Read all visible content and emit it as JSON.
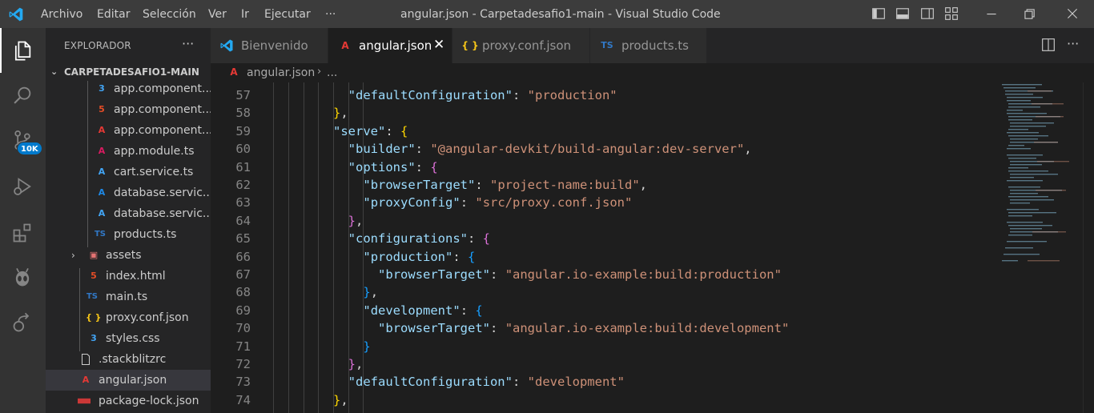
{
  "colors": {
    "accent": "#007acc",
    "titlebar": "#3c3c3c",
    "activitybar": "#333333",
    "sidebar": "#252526",
    "editor": "#1e1e1e",
    "json_key": "#9cdcfe",
    "json_string": "#ce9178",
    "bracket_1": "#da70d6",
    "bracket_2": "#179fff",
    "bracket_3": "#ffd700"
  },
  "titlebar": {
    "menu": [
      "Archivo",
      "Editar",
      "Selección",
      "Ver",
      "Ir",
      "Ejecutar",
      "···"
    ],
    "title": "angular.json - Carpetadesafio1-main - Visual Studio Code",
    "icons": [
      "toggle-primary-sidebar-icon",
      "toggle-panel-icon",
      "toggle-secondary-sidebar-icon",
      "customize-layout-icon",
      "minimize-icon",
      "restore-icon",
      "close-icon"
    ]
  },
  "activitybar": {
    "icons": [
      "explorer-icon",
      "search-icon",
      "source-control-icon",
      "run-debug-icon",
      "extensions-icon",
      "alien-icon",
      "remote-explorer-icon"
    ],
    "badge": "10K"
  },
  "sidebar": {
    "title": "EXPLORADOR",
    "more": "···",
    "folder": "CARPETADESAFIO1-MAIN",
    "items": [
      {
        "label": "app.component....",
        "icon": "css-file-icon"
      },
      {
        "label": "app.component....",
        "icon": "html-file-icon"
      },
      {
        "label": "app.component....",
        "icon": "angular-file-icon"
      },
      {
        "label": "app.module.ts",
        "icon": "angular-module-icon"
      },
      {
        "label": "cart.service.ts",
        "icon": "angular-service-icon"
      },
      {
        "label": "database.servic...",
        "icon": "angular-service-spec-icon"
      },
      {
        "label": "database.servic...",
        "icon": "angular-service-icon"
      },
      {
        "label": "products.ts",
        "icon": "typescript-file-icon"
      },
      {
        "label": "assets",
        "icon": "assets-folder-icon"
      },
      {
        "label": "index.html",
        "icon": "html-file-icon"
      },
      {
        "label": "main.ts",
        "icon": "typescript-file-icon"
      },
      {
        "label": "proxy.conf.json",
        "icon": "json-file-icon"
      },
      {
        "label": "styles.css",
        "icon": "css-file-icon"
      },
      {
        "label": ".stackblitzrc",
        "icon": "plain-file-icon"
      },
      {
        "label": "angular.json",
        "icon": "angular-file-icon"
      },
      {
        "label": "package-lock.json",
        "icon": "npm-file-icon"
      }
    ]
  },
  "tabs": [
    {
      "label": "Bienvenido",
      "icon": "vscode-icon"
    },
    {
      "label": "angular.json",
      "icon": "angular-file-icon",
      "close": "✕"
    },
    {
      "label": "proxy.conf.json",
      "icon": "json-file-icon"
    },
    {
      "label": "products.ts",
      "icon": "typescript-file-icon"
    }
  ],
  "tab_icon_text": {
    "json": "{ }",
    "ts": "TS"
  },
  "breadcrumb": {
    "file": "angular.json",
    "separator": "›",
    "more": "..."
  },
  "editor": {
    "lines": [
      {
        "n": "57",
        "indent": 5,
        "tokens": [
          {
            "t": "\"defaultConfiguration\"",
            "c": "k"
          },
          {
            "t": ": ",
            "c": "p"
          },
          {
            "t": "\"production\"",
            "c": "s"
          }
        ]
      },
      {
        "n": "58",
        "indent": 4,
        "tokens": [
          {
            "t": "}",
            "c": "b3"
          },
          {
            "t": ",",
            "c": "p"
          }
        ]
      },
      {
        "n": "59",
        "indent": 4,
        "tokens": [
          {
            "t": "\"serve\"",
            "c": "k"
          },
          {
            "t": ": ",
            "c": "p"
          },
          {
            "t": "{",
            "c": "b3"
          }
        ]
      },
      {
        "n": "60",
        "indent": 5,
        "tokens": [
          {
            "t": "\"builder\"",
            "c": "k"
          },
          {
            "t": ": ",
            "c": "p"
          },
          {
            "t": "\"@angular-devkit/build-angular:dev-server\"",
            "c": "s"
          },
          {
            "t": ",",
            "c": "p"
          }
        ]
      },
      {
        "n": "61",
        "indent": 5,
        "tokens": [
          {
            "t": "\"options\"",
            "c": "k"
          },
          {
            "t": ": ",
            "c": "p"
          },
          {
            "t": "{",
            "c": "b1"
          }
        ]
      },
      {
        "n": "62",
        "indent": 6,
        "tokens": [
          {
            "t": "\"browserTarget\"",
            "c": "k"
          },
          {
            "t": ": ",
            "c": "p"
          },
          {
            "t": "\"project-name:build\"",
            "c": "s"
          },
          {
            "t": ",",
            "c": "p"
          }
        ]
      },
      {
        "n": "63",
        "indent": 6,
        "tokens": [
          {
            "t": "\"proxyConfig\"",
            "c": "k"
          },
          {
            "t": ": ",
            "c": "p"
          },
          {
            "t": "\"src/proxy.conf.json\"",
            "c": "s"
          }
        ]
      },
      {
        "n": "64",
        "indent": 5,
        "tokens": [
          {
            "t": "}",
            "c": "b1"
          },
          {
            "t": ",",
            "c": "p"
          }
        ]
      },
      {
        "n": "65",
        "indent": 5,
        "tokens": [
          {
            "t": "\"configurations\"",
            "c": "k"
          },
          {
            "t": ": ",
            "c": "p"
          },
          {
            "t": "{",
            "c": "b1"
          }
        ]
      },
      {
        "n": "66",
        "indent": 6,
        "tokens": [
          {
            "t": "\"production\"",
            "c": "k"
          },
          {
            "t": ": ",
            "c": "p"
          },
          {
            "t": "{",
            "c": "b2"
          }
        ]
      },
      {
        "n": "67",
        "indent": 7,
        "tokens": [
          {
            "t": "\"browserTarget\"",
            "c": "k"
          },
          {
            "t": ": ",
            "c": "p"
          },
          {
            "t": "\"angular.io-example:build:production\"",
            "c": "s"
          }
        ]
      },
      {
        "n": "68",
        "indent": 6,
        "tokens": [
          {
            "t": "}",
            "c": "b2"
          },
          {
            "t": ",",
            "c": "p"
          }
        ]
      },
      {
        "n": "69",
        "indent": 6,
        "tokens": [
          {
            "t": "\"development\"",
            "c": "k"
          },
          {
            "t": ": ",
            "c": "p"
          },
          {
            "t": "{",
            "c": "b2"
          }
        ]
      },
      {
        "n": "70",
        "indent": 7,
        "tokens": [
          {
            "t": "\"browserTarget\"",
            "c": "k"
          },
          {
            "t": ": ",
            "c": "p"
          },
          {
            "t": "\"angular.io-example:build:development\"",
            "c": "s"
          }
        ]
      },
      {
        "n": "71",
        "indent": 6,
        "tokens": [
          {
            "t": "}",
            "c": "b2"
          }
        ]
      },
      {
        "n": "72",
        "indent": 5,
        "tokens": [
          {
            "t": "}",
            "c": "b1"
          },
          {
            "t": ",",
            "c": "p"
          }
        ]
      },
      {
        "n": "73",
        "indent": 5,
        "tokens": [
          {
            "t": "\"defaultConfiguration\"",
            "c": "k"
          },
          {
            "t": ": ",
            "c": "p"
          },
          {
            "t": "\"development\"",
            "c": "s"
          }
        ]
      },
      {
        "n": "74",
        "indent": 4,
        "tokens": [
          {
            "t": "}",
            "c": "b3"
          },
          {
            "t": ",",
            "c": "p"
          }
        ]
      }
    ]
  }
}
